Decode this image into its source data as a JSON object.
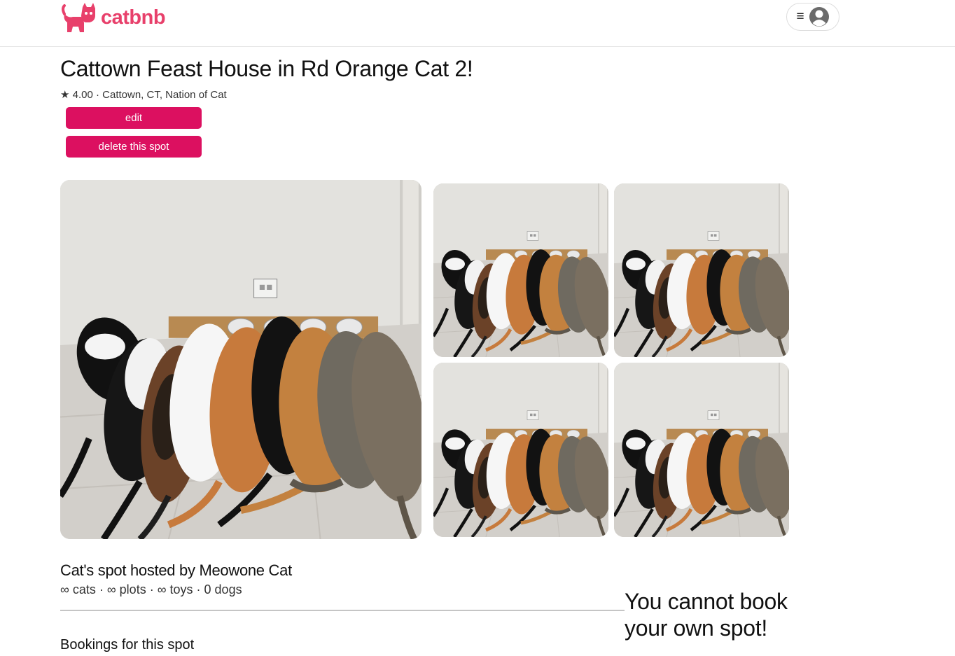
{
  "brand": {
    "name": "catbnb",
    "color": "#e8406b",
    "icon": "cat-logo-icon"
  },
  "header": {
    "menu_icon": "hamburger-icon",
    "menu_glyph": "≡",
    "avatar_icon": "user-avatar-icon"
  },
  "spot": {
    "title": "Cattown Feast House in Rd Orange Cat 2!",
    "subline": "★ 4.00 · Cattown, CT, Nation of Cat",
    "rating": "4.00",
    "location": "Cattown, CT, Nation of Cat"
  },
  "actions": {
    "edit_label": "edit",
    "delete_label": "delete this spot",
    "button_color": "#dc1060"
  },
  "photos": {
    "count": 5,
    "subject": "cats-eating-in-a-row-photo"
  },
  "host": {
    "heading": "Cat's spot hosted by Meowone Cat",
    "amenities": "∞ cats · ∞ plots · ∞ toys · 0 dogs"
  },
  "bookings": {
    "heading": "Bookings for this spot"
  },
  "booking_panel": {
    "message": "You cannot book your own spot!"
  }
}
